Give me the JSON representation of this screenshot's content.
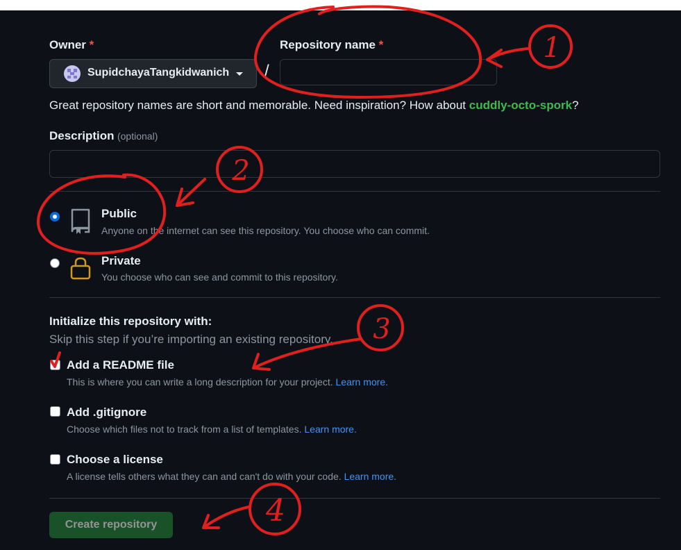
{
  "form": {
    "owner_label": "Owner",
    "required_mark": "*",
    "owner_value": "SupidchayaTangkidwanich",
    "separator": "/",
    "repo_name_label": "Repository name",
    "repo_name_value": "",
    "hint_prefix": "Great repository names are short and memorable. Need inspiration? How about ",
    "hint_suggestion": "cuddly-octo-spork",
    "hint_suffix": "?",
    "description_label": "Description",
    "description_optional": "(optional)",
    "description_value": ""
  },
  "visibility": {
    "selected": "public",
    "options": [
      {
        "title": "Public",
        "desc": "Anyone on the internet can see this repository. You choose who can commit.",
        "icon": "repo-icon"
      },
      {
        "title": "Private",
        "desc": "You choose who can see and commit to this repository.",
        "icon": "lock-icon"
      }
    ]
  },
  "init": {
    "heading": "Initialize this repository with:",
    "subheading": "Skip this step if you’re importing an existing repository.",
    "options": [
      {
        "title": "Add a README file",
        "desc": "This is where you can write a long description for your project.",
        "link": "Learn more.",
        "checked": true
      },
      {
        "title": "Add .gitignore",
        "desc": "Choose which files not to track from a list of templates.",
        "link": "Learn more.",
        "checked": false
      },
      {
        "title": "Choose a license",
        "desc": "A license tells others what they can and can't do with your code.",
        "link": "Learn more.",
        "checked": false
      }
    ]
  },
  "submit": {
    "label": "Create repository"
  },
  "annotations": {
    "n1": "1",
    "n2": "2",
    "n3": "3",
    "n4": "4",
    "color": "#e0201e"
  },
  "colors": {
    "background": "#0d1117",
    "border": "#30363d",
    "link": "#4493f8",
    "suggestion": "#3fb950",
    "button": "#238636",
    "required": "#f85149",
    "lock": "#d29922"
  }
}
